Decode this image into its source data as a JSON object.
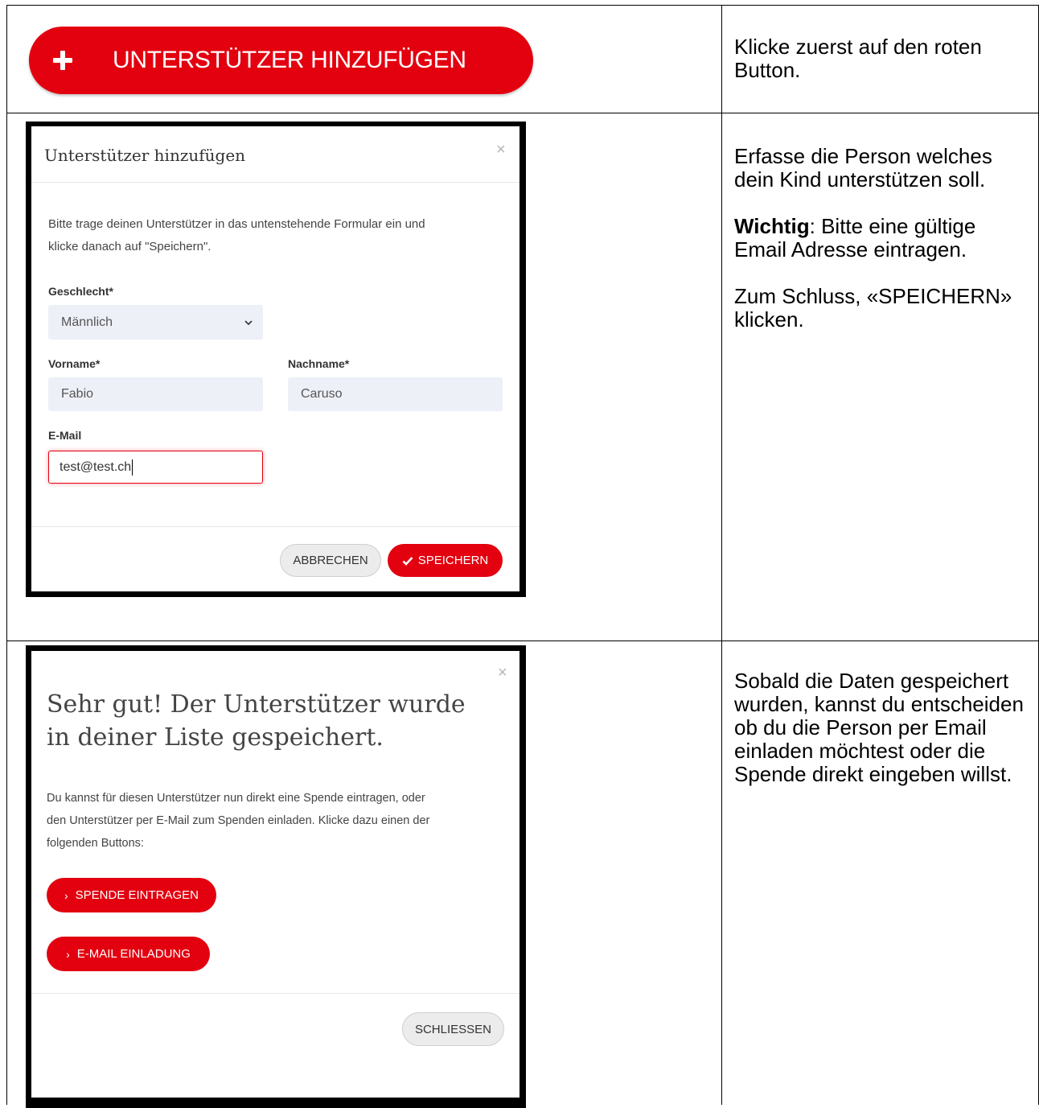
{
  "row1": {
    "button_label": "UNTERSTÜTZER HINZUFÜGEN",
    "instruction": "Klicke zuerst auf den roten Button."
  },
  "row2": {
    "modal": {
      "title": "Unterstützer hinzufügen",
      "close": "×",
      "intro_line1": "Bitte trage deinen Unterstützer in das untenstehende Formular ein und",
      "intro_line2": "klicke danach auf \"Speichern\".",
      "gender_label": "Geschlecht*",
      "gender_value": "Männlich",
      "firstname_label": "Vorname*",
      "firstname_value": "Fabio",
      "lastname_label": "Nachname*",
      "lastname_value": "Caruso",
      "email_label": "E-Mail",
      "email_value": "test@test.ch",
      "cancel_label": "ABBRECHEN",
      "save_label": "SPEICHERN"
    },
    "instruction_p1": "Erfasse die Person welches dein Kind unterstützen soll.",
    "instruction_important_strong": "Wichtig",
    "instruction_important_rest": ": Bitte eine gültige Email Adresse eintragen.",
    "instruction_p3": "Zum Schluss, «SPEICHERN» klicken."
  },
  "row3": {
    "modal": {
      "close": "×",
      "heading_line1": "Sehr gut! Der Unterstützer wurde",
      "heading_line2": "in deiner Liste gespeichert.",
      "text_line1": "Du kannst für diesen Unterstützer nun direkt eine Spende eintragen, oder",
      "text_line2": "den Unterstützer per E-Mail zum Spenden einladen. Klicke dazu einen der",
      "text_line3": "folgenden Buttons:",
      "donation_button": "SPENDE EINTRAGEN",
      "email_button": "E-MAIL EINLADUNG",
      "close_button": "SCHLIESSEN"
    },
    "instruction": "Sobald die Daten gespeichert wurden, kannst du entscheiden ob du die Person per Email einladen möchtest oder die Spende direkt eingeben willst."
  },
  "colors": {
    "brand_red": "#e3000f",
    "field_bg": "#eef0f8"
  }
}
